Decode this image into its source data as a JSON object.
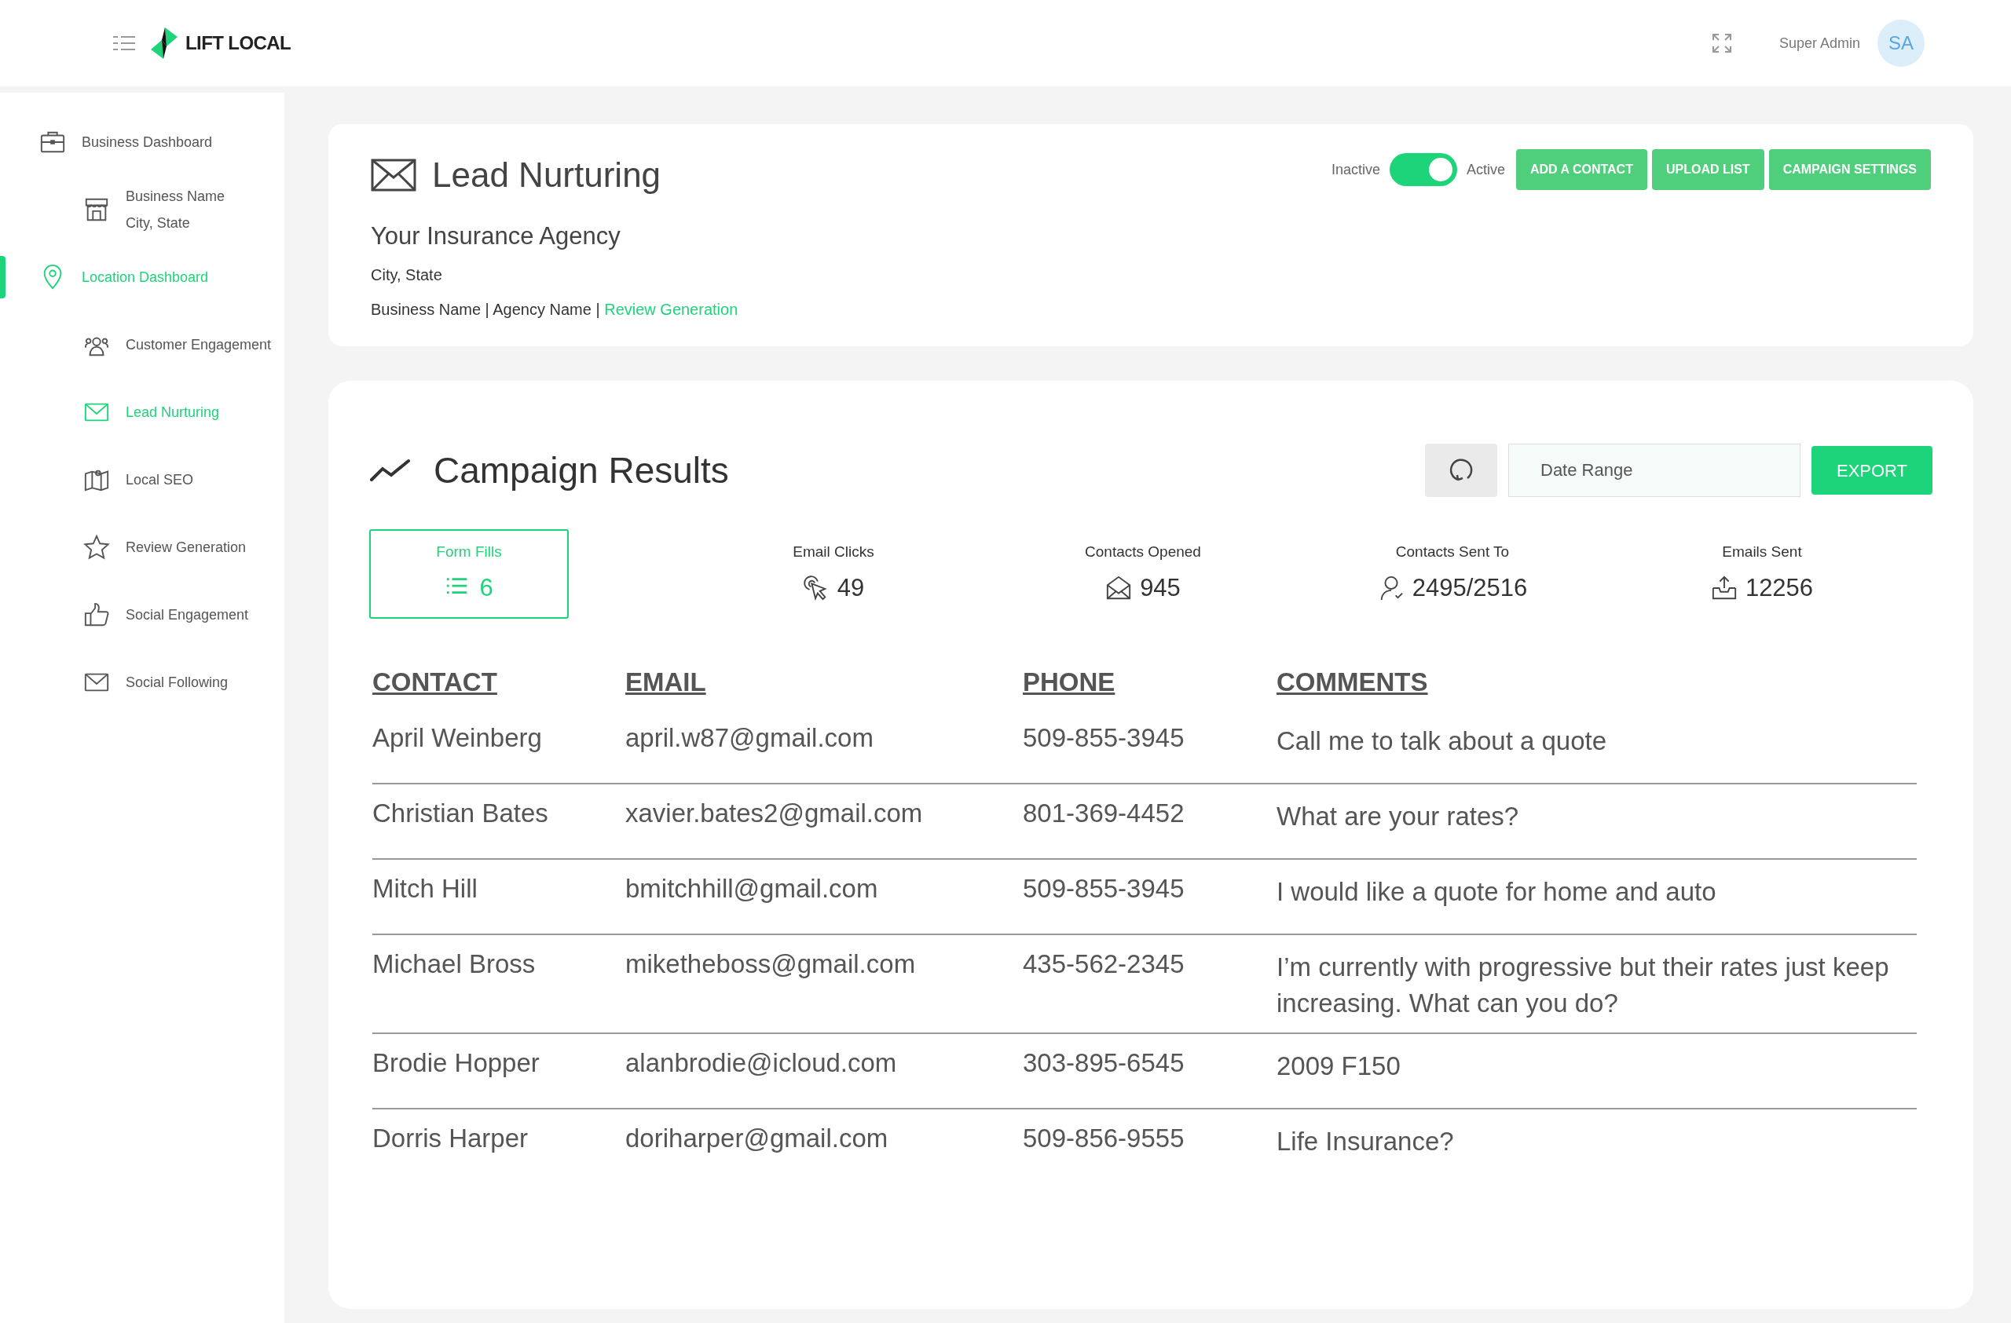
{
  "brand": "LIFT LOCAL",
  "user": {
    "name": "Super Admin",
    "initials": "SA"
  },
  "sidebar": {
    "items": [
      {
        "label": "Business Dashboard",
        "selected": false,
        "children": [
          {
            "label": "Business Name\nCity, State",
            "selected": false
          }
        ]
      },
      {
        "label": "Location Dashboard",
        "selected": true,
        "children": [
          {
            "label": "Customer Engagement",
            "selected": false
          },
          {
            "label": "Lead Nurturing",
            "selected": true
          },
          {
            "label": "Local SEO",
            "selected": false
          },
          {
            "label": "Review Generation",
            "selected": false
          },
          {
            "label": "Social Engagement",
            "selected": false
          },
          {
            "label": "Social Following",
            "selected": false
          }
        ]
      }
    ]
  },
  "header": {
    "title": "Lead Nurturing",
    "agency": "Your Insurance Agency",
    "location": "City, State",
    "breadcrumb": "Business Name | Agency Name |",
    "breadcrumb_link": "Review Generation",
    "toggle": {
      "off_label": "Inactive",
      "on_label": "Active",
      "on": true
    },
    "buttons": [
      "ADD A CONTACT",
      "UPLOAD LIST",
      "CAMPAIGN SETTINGS"
    ]
  },
  "results": {
    "title": "Campaign Results",
    "date_range": {
      "placeholder": "Date Range"
    },
    "export": "EXPORT",
    "stats": [
      {
        "kind": "list",
        "label": "Form Fills",
        "value": "6",
        "selected": true
      },
      {
        "kind": "click",
        "label": "Email Clicks",
        "value": "49",
        "selected": false
      },
      {
        "kind": "opened",
        "label": "Contacts Opened",
        "value": "945",
        "selected": false
      },
      {
        "kind": "person",
        "label": "Contacts Sent To",
        "value": "2495/2516",
        "selected": false
      },
      {
        "kind": "sent",
        "label": "Emails Sent",
        "value": "12256",
        "selected": false
      }
    ],
    "table": {
      "columns": [
        "CONTACT",
        "EMAIL",
        "PHONE",
        "COMMENTS"
      ],
      "rows": [
        [
          "April Weinberg",
          "april.w87@gmail.com",
          "509-855-3945",
          "Call me to talk about a quote"
        ],
        [
          "Christian Bates",
          "xavier.bates2@gmail.com",
          "801-369-4452",
          "What are your rates?"
        ],
        [
          "Mitch Hill",
          "bmitchhill@gmail.com",
          "509-855-3945",
          "I would like a quote for home and auto"
        ],
        [
          "Michael Bross",
          "miketheboss@gmail.com",
          "435-562-2345",
          "I’m currently with progressive but their rates just keep increasing. What can you do?"
        ],
        [
          "Brodie Hopper",
          "alanbrodie@icloud.com",
          "303-895-6545",
          "2009 F150"
        ],
        [
          "Dorris Harper",
          "doriharper@gmail.com",
          "509-856-9555",
          "Life Insurance?"
        ]
      ]
    }
  }
}
